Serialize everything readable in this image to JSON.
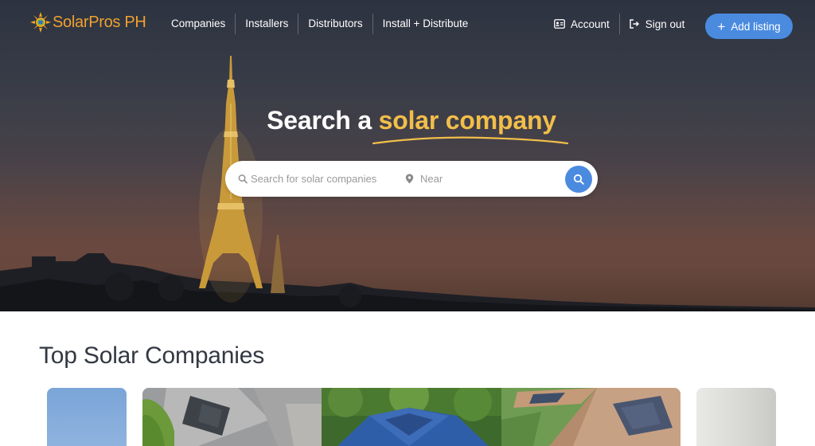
{
  "brand": {
    "name": "SolarPros PH",
    "color": "#f0a030"
  },
  "nav": {
    "links": [
      "Companies",
      "Installers",
      "Distributors",
      "Install + Distribute"
    ],
    "account_label": "Account",
    "signout_label": "Sign out",
    "add_listing_label": "Add listing",
    "accent_color": "#4a8be0"
  },
  "hero": {
    "headline_prefix": "Search a ",
    "headline_accent": "solar company",
    "accent_color": "#f2be4a",
    "search": {
      "query_placeholder": "Search for solar companies",
      "location_placeholder": "Near"
    },
    "icons": [
      "search-icon",
      "location-pin-icon"
    ]
  },
  "section": {
    "title": "Top Solar Companies",
    "cards": [
      "company-card",
      "company-card",
      "company-card",
      "company-card",
      "company-card"
    ]
  }
}
